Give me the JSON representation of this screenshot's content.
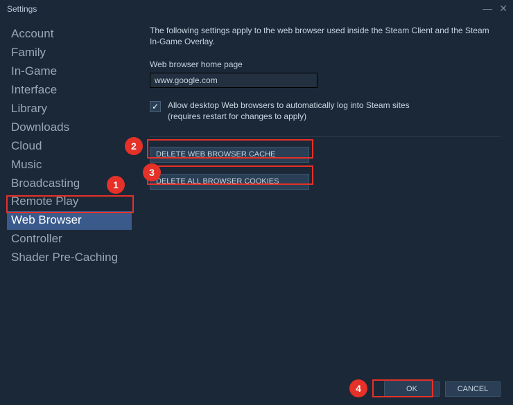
{
  "window": {
    "title": "Settings"
  },
  "sidebar": {
    "items": [
      {
        "label": "Account"
      },
      {
        "label": "Family"
      },
      {
        "label": "In-Game"
      },
      {
        "label": "Interface"
      },
      {
        "label": "Library"
      },
      {
        "label": "Downloads"
      },
      {
        "label": "Cloud"
      },
      {
        "label": "Music"
      },
      {
        "label": "Broadcasting"
      },
      {
        "label": "Remote Play"
      },
      {
        "label": "Web Browser",
        "selected": true
      },
      {
        "label": "Controller"
      },
      {
        "label": "Shader Pre-Caching"
      }
    ]
  },
  "main": {
    "description": "The following settings apply to the web browser used inside the Steam Client and the Steam In-Game Overlay.",
    "homepage_label": "Web browser home page",
    "homepage_value": "www.google.com",
    "checkbox_checked": true,
    "checkbox_line1": "Allow desktop Web browsers to automatically log into Steam sites",
    "checkbox_line2": "(requires restart for changes to apply)",
    "delete_cache_label": "DELETE WEB BROWSER CACHE",
    "delete_cookies_label": "DELETE ALL BROWSER COOKIES"
  },
  "footer": {
    "ok_label": "OK",
    "cancel_label": "CANCEL"
  },
  "annotations": {
    "b1": "1",
    "b2": "2",
    "b3": "3",
    "b4": "4"
  }
}
